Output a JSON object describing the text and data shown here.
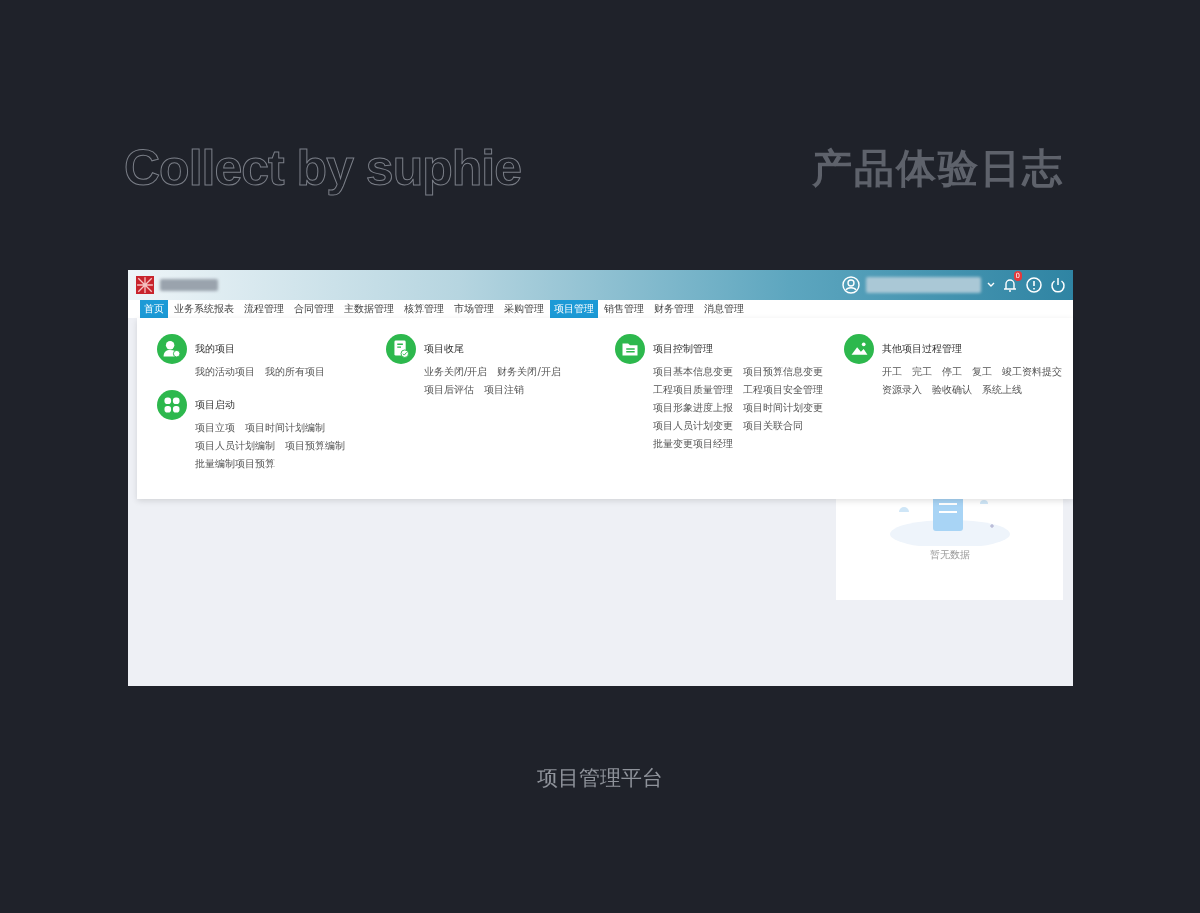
{
  "slide": {
    "watermark_title": "Collect by suphie",
    "title": "产品体验日志",
    "caption": "项目管理平台"
  },
  "header": {
    "notification_count": "0"
  },
  "nav": [
    {
      "label": "首页",
      "selected": true
    },
    {
      "label": "业务系统报表",
      "selected": false
    },
    {
      "label": "流程管理",
      "selected": false
    },
    {
      "label": "合同管理",
      "selected": false
    },
    {
      "label": "主数据管理",
      "selected": false
    },
    {
      "label": "核算管理",
      "selected": false
    },
    {
      "label": "市场管理",
      "selected": false
    },
    {
      "label": "采购管理",
      "selected": false
    },
    {
      "label": "项目管理",
      "selected": true
    },
    {
      "label": "销售管理",
      "selected": false
    },
    {
      "label": "财务管理",
      "selected": false
    },
    {
      "label": "消息管理",
      "selected": false
    }
  ],
  "menu_columns": [
    [
      {
        "title": "我的项目",
        "kind": "user",
        "links": [
          "我的活动项目",
          "我的所有项目"
        ]
      },
      {
        "title": "项目启动",
        "kind": "grid",
        "links": [
          "项目立项",
          "项目时间计划编制",
          "项目人员计划编制",
          "项目预算编制",
          "批量编制项目预算"
        ]
      }
    ],
    [
      {
        "title": "项目收尾",
        "kind": "doc",
        "links": [
          "业务关闭/开启",
          "财务关闭/开启",
          "项目后评估",
          "项目注销"
        ]
      }
    ],
    [
      {
        "title": "项目控制管理",
        "kind": "folder",
        "links": [
          "项目基本信息变更",
          "项目预算信息变更",
          "工程项目质量管理",
          "工程项目安全管理",
          "项目形象进度上报",
          "项目时间计划变更",
          "项目人员计划变更",
          "项目关联合同",
          "批量变更项目经理"
        ]
      }
    ],
    [
      {
        "title": "其他项目过程管理",
        "kind": "image",
        "links": [
          "开工",
          "完工",
          "停工",
          "复工",
          "竣工资料提交",
          "资源录入",
          "验收确认",
          "系统上线"
        ]
      }
    ]
  ],
  "empty_card": {
    "text": "暂无数据"
  }
}
